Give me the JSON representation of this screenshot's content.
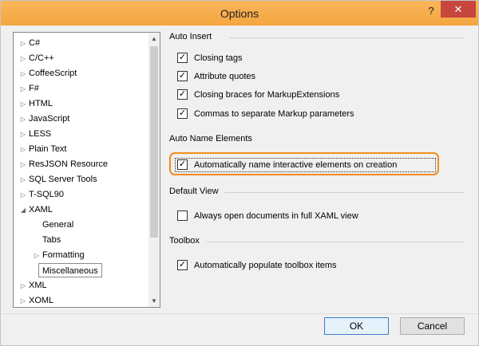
{
  "window": {
    "title": "Options",
    "help": "?",
    "close": "✕"
  },
  "tree": {
    "items": [
      {
        "label": "C#",
        "arrow": "▷"
      },
      {
        "label": "C/C++",
        "arrow": "▷"
      },
      {
        "label": "CoffeeScript",
        "arrow": "▷"
      },
      {
        "label": "F#",
        "arrow": "▷"
      },
      {
        "label": "HTML",
        "arrow": "▷"
      },
      {
        "label": "JavaScript",
        "arrow": "▷"
      },
      {
        "label": "LESS",
        "arrow": "▷"
      },
      {
        "label": "Plain Text",
        "arrow": "▷"
      },
      {
        "label": "ResJSON Resource",
        "arrow": "▷"
      },
      {
        "label": "SQL Server Tools",
        "arrow": "▷"
      },
      {
        "label": "T-SQL90",
        "arrow": "▷"
      },
      {
        "label": "XAML",
        "arrow": "◢"
      },
      {
        "label": "General",
        "arrow": ""
      },
      {
        "label": "Tabs",
        "arrow": ""
      },
      {
        "label": "Formatting",
        "arrow": "▷"
      },
      {
        "label": "Miscellaneous",
        "arrow": ""
      },
      {
        "label": "XML",
        "arrow": "▷"
      },
      {
        "label": "XOML",
        "arrow": "▷"
      }
    ]
  },
  "sections": {
    "auto_insert": "Auto Insert",
    "auto_name": "Auto Name Elements",
    "default_view": "Default View",
    "toolbox": "Toolbox"
  },
  "options": {
    "closing_tags": {
      "label": "Closing tags",
      "checked": true
    },
    "attribute_quotes": {
      "label": "Attribute quotes",
      "checked": true
    },
    "closing_braces": {
      "label": "Closing braces for MarkupExtensions",
      "checked": true
    },
    "commas": {
      "label": "Commas to separate Markup parameters",
      "checked": true
    },
    "auto_name": {
      "label": "Automatically name interactive elements on creation",
      "checked": true
    },
    "full_xaml": {
      "label": "Always open documents in full XAML view",
      "checked": false
    },
    "populate_toolbox": {
      "label": "Automatically populate toolbox items",
      "checked": true
    }
  },
  "buttons": {
    "ok": "OK",
    "cancel": "Cancel"
  },
  "colors": {
    "titlebar": "#f4a640",
    "highlight": "#f08c1c",
    "close": "#c7463d"
  }
}
